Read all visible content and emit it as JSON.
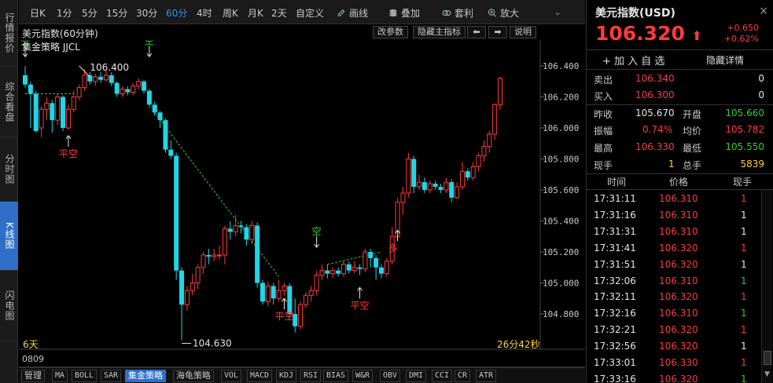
{
  "nav": [
    "行情报价",
    "综合看盘",
    "分时图",
    "K线图",
    "闪电图"
  ],
  "nav_active": 3,
  "toolbar": {
    "periods": [
      "日K",
      "1分",
      "5分",
      "15分",
      "30分",
      "60分",
      "4时",
      "周K",
      "月K",
      "2天",
      "自定义"
    ],
    "active_period": 5,
    "tools": [
      "画线",
      "叠加",
      "套利",
      "放大"
    ]
  },
  "chart_head": {
    "title": "美元指数(60分钟)",
    "indicator": "集金策略 JJCL",
    "btn_params": "改参数",
    "btn_hide": "隐藏主指标",
    "btn_help": "说明"
  },
  "chart_data": {
    "type": "candlestick",
    "y_ticks": [
      "106.400",
      "106.200",
      "106.000",
      "105.800",
      "105.600",
      "105.400",
      "105.200",
      "105.000",
      "104.800"
    ],
    "ylim": [
      104.68,
      106.52
    ],
    "high_label": "106.400",
    "low_label": "104.630",
    "range_label": "6天",
    "countdown": "26分42秒",
    "x_label": "0809",
    "signals": [
      "空",
      "空",
      "平空",
      "平空",
      "空",
      "平空",
      "多"
    ],
    "candles": [
      [
        106.34,
        106.28,
        106.4,
        106.26
      ],
      [
        106.28,
        106.22,
        106.3,
        106.0
      ],
      [
        106.22,
        105.98,
        106.24,
        105.97
      ],
      [
        106.0,
        106.12,
        106.14,
        105.94
      ],
      [
        106.12,
        106.16,
        106.2,
        106.05
      ],
      [
        106.16,
        106.05,
        106.18,
        105.97
      ],
      [
        106.05,
        106.2,
        106.22,
        106.02
      ],
      [
        106.2,
        106.0,
        106.21,
        105.98
      ],
      [
        106.0,
        106.12,
        106.15,
        105.99
      ],
      [
        106.12,
        106.2,
        106.24,
        106.1
      ],
      [
        106.2,
        106.26,
        106.28,
        106.18
      ],
      [
        106.26,
        106.34,
        106.38,
        106.24
      ],
      [
        106.34,
        106.3,
        106.36,
        106.28
      ],
      [
        106.3,
        106.33,
        106.35,
        106.27
      ],
      [
        106.33,
        106.31,
        106.36,
        106.29
      ],
      [
        106.31,
        106.34,
        106.37,
        106.3
      ],
      [
        106.34,
        106.29,
        106.36,
        106.27
      ],
      [
        106.29,
        106.22,
        106.3,
        106.2
      ],
      [
        106.22,
        106.25,
        106.27,
        106.2
      ],
      [
        106.25,
        106.23,
        106.27,
        106.21
      ],
      [
        106.23,
        106.27,
        106.29,
        106.21
      ],
      [
        106.27,
        106.3,
        106.32,
        106.25
      ],
      [
        106.3,
        106.24,
        106.31,
        106.22
      ],
      [
        106.24,
        106.15,
        106.25,
        106.13
      ],
      [
        106.15,
        106.1,
        106.17,
        106.08
      ],
      [
        106.1,
        106.05,
        106.11,
        106.0
      ],
      [
        106.05,
        105.86,
        106.06,
        105.84
      ],
      [
        105.86,
        105.82,
        105.92,
        105.8
      ],
      [
        105.82,
        105.08,
        105.84,
        105.02
      ],
      [
        105.08,
        104.86,
        105.1,
        104.63
      ],
      [
        104.86,
        104.95,
        104.98,
        104.82
      ],
      [
        104.95,
        105.0,
        105.06,
        104.92
      ],
      [
        105.0,
        105.1,
        105.12,
        104.96
      ],
      [
        105.1,
        105.18,
        105.2,
        105.06
      ],
      [
        105.18,
        105.17,
        105.22,
        105.12
      ],
      [
        105.17,
        105.18,
        105.22,
        105.14
      ],
      [
        105.18,
        105.18,
        105.24,
        105.15
      ],
      [
        105.18,
        105.35,
        105.37,
        105.12
      ],
      [
        105.35,
        105.33,
        105.4,
        105.28
      ],
      [
        105.33,
        105.37,
        105.44,
        105.3
      ],
      [
        105.37,
        105.36,
        105.4,
        105.32
      ],
      [
        105.36,
        105.28,
        105.38,
        105.24
      ],
      [
        105.28,
        105.37,
        105.4,
        105.25
      ],
      [
        105.37,
        105.0,
        105.39,
        104.97
      ],
      [
        105.0,
        104.88,
        105.02,
        104.86
      ],
      [
        104.88,
        104.98,
        105.01,
        104.85
      ],
      [
        104.98,
        104.9,
        105.0,
        104.86
      ],
      [
        104.9,
        104.95,
        105.02,
        104.88
      ],
      [
        104.95,
        104.98,
        105.0,
        104.92
      ],
      [
        104.98,
        104.8,
        105.0,
        104.78
      ],
      [
        104.8,
        104.72,
        104.9,
        104.68
      ],
      [
        104.72,
        104.86,
        104.88,
        104.7
      ],
      [
        104.86,
        104.92,
        104.94,
        104.84
      ],
      [
        104.92,
        104.95,
        104.98,
        104.88
      ],
      [
        104.95,
        105.05,
        105.08,
        104.92
      ],
      [
        105.05,
        105.08,
        105.12,
        105.02
      ],
      [
        105.08,
        105.06,
        105.12,
        105.03
      ],
      [
        105.06,
        105.08,
        105.1,
        105.03
      ],
      [
        105.08,
        105.06,
        105.1,
        105.04
      ],
      [
        105.06,
        105.12,
        105.14,
        105.04
      ],
      [
        105.12,
        105.08,
        105.14,
        105.06
      ],
      [
        105.08,
        105.1,
        105.14,
        105.06
      ],
      [
        105.1,
        105.09,
        105.12,
        105.05
      ],
      [
        105.09,
        105.2,
        105.22,
        105.07
      ],
      [
        105.2,
        105.16,
        105.22,
        105.1
      ],
      [
        105.16,
        105.1,
        105.18,
        105.02
      ],
      [
        105.1,
        105.06,
        105.12,
        105.03
      ],
      [
        105.06,
        105.14,
        105.16,
        105.04
      ],
      [
        105.14,
        105.3,
        105.36,
        105.12
      ],
      [
        105.3,
        105.52,
        105.55,
        105.28
      ],
      [
        105.52,
        105.58,
        105.62,
        105.44
      ],
      [
        105.58,
        105.8,
        105.84,
        105.55
      ],
      [
        105.8,
        105.62,
        105.82,
        105.58
      ],
      [
        105.62,
        105.65,
        105.7,
        105.6
      ],
      [
        105.65,
        105.6,
        105.68,
        105.58
      ],
      [
        105.6,
        105.64,
        105.66,
        105.58
      ],
      [
        105.64,
        105.62,
        105.66,
        105.6
      ],
      [
        105.62,
        105.6,
        105.64,
        105.58
      ],
      [
        105.6,
        105.65,
        105.68,
        105.58
      ],
      [
        105.65,
        105.55,
        105.67,
        105.52
      ],
      [
        105.55,
        105.62,
        105.65,
        105.54
      ],
      [
        105.62,
        105.72,
        105.78,
        105.6
      ],
      [
        105.72,
        105.68,
        105.74,
        105.66
      ],
      [
        105.68,
        105.75,
        105.78,
        105.66
      ],
      [
        105.75,
        105.82,
        105.84,
        105.72
      ],
      [
        105.82,
        105.88,
        105.92,
        105.78
      ],
      [
        105.88,
        105.96,
        105.98,
        105.84
      ],
      [
        105.96,
        106.15,
        106.16,
        105.92
      ],
      [
        106.15,
        106.32,
        106.33,
        106.12
      ]
    ]
  },
  "right_panel": {
    "title": "美元指数(USD)",
    "close": "×",
    "price": "106.320",
    "arrow": "⬆",
    "change": "+0.650",
    "change_pct": "+0.62%",
    "add_fav": "+ 加 入 自 选",
    "hide_detail": "隐藏详情",
    "sell_label": "卖出",
    "sell_price": "106.340",
    "sell_qty": "0",
    "buy_label": "买入",
    "buy_price": "106.300",
    "buy_qty": "0",
    "prev_label": "昨收",
    "prev": "105.670",
    "open_label": "开盘",
    "open": "105.660",
    "amp_label": "振幅",
    "amp": "0.74%",
    "avg_label": "均价",
    "avg": "105.782",
    "high_label": "最高",
    "high": "106.330",
    "low_label": "最低",
    "low": "105.550",
    "cur_label": "现手",
    "cur": "1",
    "tot_label": "总手",
    "tot": "5839",
    "ticks_header": [
      "时间",
      "价格",
      "现手"
    ],
    "ticks": [
      [
        "17:31:11",
        "106.310",
        "1",
        "red"
      ],
      [
        "17:31:16",
        "106.310",
        "1",
        "white"
      ],
      [
        "17:31:31",
        "106.310",
        "1",
        "white"
      ],
      [
        "17:31:41",
        "106.320",
        "1",
        "red"
      ],
      [
        "17:31:51",
        "106.320",
        "1",
        "white"
      ],
      [
        "17:32:06",
        "106.310",
        "1",
        "green"
      ],
      [
        "17:32:11",
        "106.320",
        "1",
        "red"
      ],
      [
        "17:32:16",
        "106.310",
        "1",
        "green"
      ],
      [
        "17:32:21",
        "106.320",
        "1",
        "red"
      ],
      [
        "17:32:56",
        "106.320",
        "1",
        "white"
      ],
      [
        "17:33:01",
        "106.330",
        "1",
        "red"
      ],
      [
        "17:33:16",
        "106.320",
        "1",
        "green"
      ]
    ]
  },
  "bottom_tabs": [
    "管理",
    "MA",
    "BOLL",
    "SAR",
    "集金策略",
    "海龟策略",
    "VOL",
    "MACD",
    "KDJ",
    "RSI",
    "BIAS",
    "W&R",
    "OBV",
    "DMI",
    "CCI",
    "CR",
    "ATR"
  ],
  "bottom_active": 4
}
